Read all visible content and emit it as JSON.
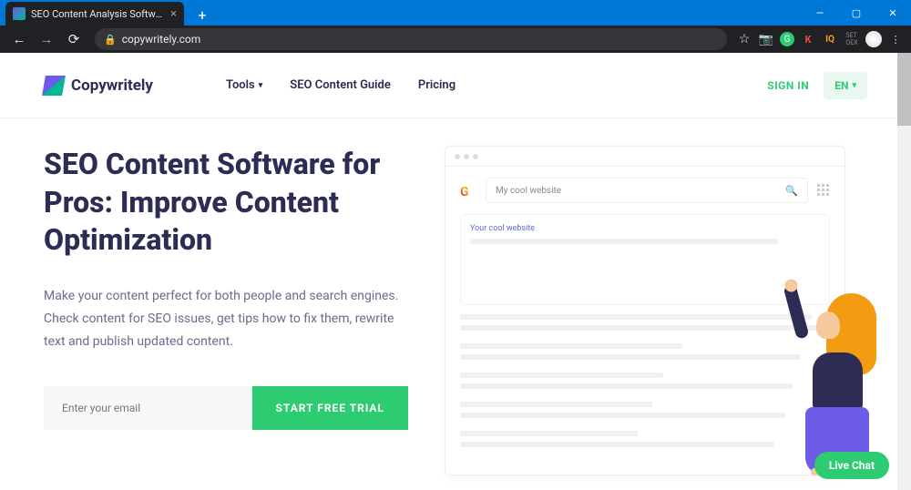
{
  "browser": {
    "tab_title": "SEO Content Analysis Software: T",
    "url": "copywritely.com"
  },
  "header": {
    "brand": "Copywritely",
    "nav": {
      "tools": "Tools",
      "guide": "SEO Content Guide",
      "pricing": "Pricing"
    },
    "signin": "SIGN IN",
    "lang": "EN"
  },
  "hero": {
    "title": "SEO Content Software for Pros: Improve Content Optimization",
    "desc": "Make your content perfect for both people and search engines. Check content for SEO issues, get tips how to fix them, rewrite text and publish updated content.",
    "email_placeholder": "Enter your email",
    "cta": "START FREE TRIAL"
  },
  "mock": {
    "query": "My cool website",
    "result_title": "Your cool website"
  },
  "chat": {
    "label": "Live Chat"
  }
}
